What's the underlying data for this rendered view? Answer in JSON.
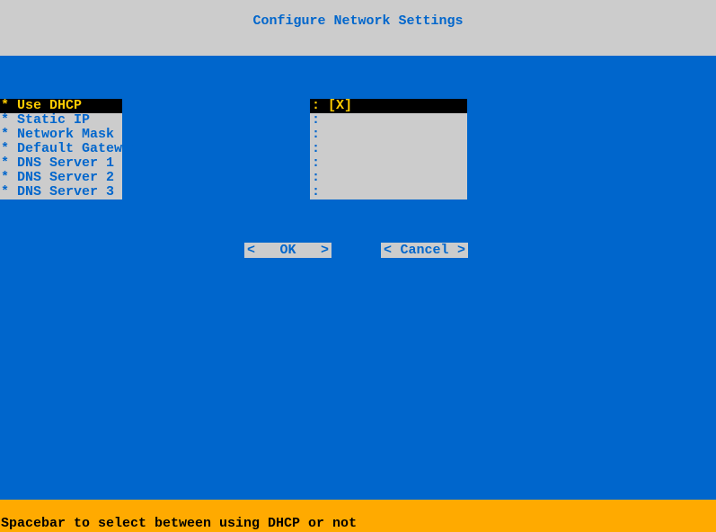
{
  "header": {
    "title": "Configure Network Settings"
  },
  "menu": {
    "items": [
      {
        "prefix": "*",
        "label": "Use DHCP",
        "selected": true
      },
      {
        "prefix": "*",
        "label": "Static IP",
        "selected": false
      },
      {
        "prefix": "*",
        "label": "Network Mask",
        "selected": false
      },
      {
        "prefix": "*",
        "label": "Default Gateway",
        "selected": false
      },
      {
        "prefix": "*",
        "label": "DNS Server 1",
        "selected": false
      },
      {
        "prefix": "*",
        "label": "DNS Server 2",
        "selected": false
      },
      {
        "prefix": "*",
        "label": "DNS Server 3",
        "selected": false
      }
    ]
  },
  "values": {
    "items": [
      {
        "prefix": ":",
        "value": "[X]",
        "selected": true
      },
      {
        "prefix": ":",
        "value": "",
        "selected": false
      },
      {
        "prefix": ":",
        "value": "",
        "selected": false
      },
      {
        "prefix": ":",
        "value": "",
        "selected": false
      },
      {
        "prefix": ":",
        "value": "",
        "selected": false
      },
      {
        "prefix": ":",
        "value": "",
        "selected": false
      },
      {
        "prefix": ":",
        "value": "",
        "selected": false
      }
    ]
  },
  "buttons": {
    "ok": {
      "left": "<",
      "label": "OK",
      "right": ">"
    },
    "cancel": {
      "left": "<",
      "label": "Cancel",
      "right": ">"
    }
  },
  "footer": {
    "hint": "Spacebar to select between using DHCP or not"
  }
}
